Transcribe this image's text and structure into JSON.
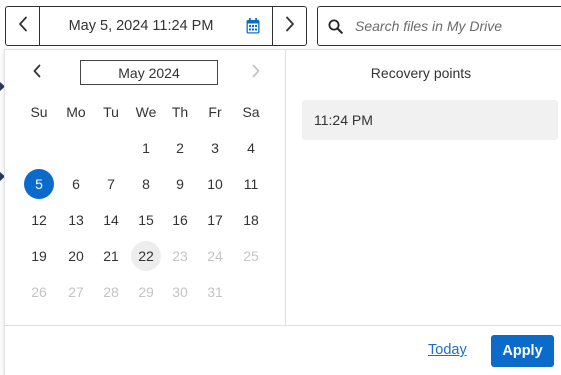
{
  "date_picker": {
    "value": "May 5, 2024 11:24 PM",
    "prev_icon": "chevron-left-icon",
    "next_icon": "chevron-right-icon",
    "calendar_icon": "calendar-icon",
    "accent_color": "#0b6bcb"
  },
  "search": {
    "placeholder": "Search files in My Drive",
    "icon": "search-icon"
  },
  "calendar": {
    "month_label": "May 2024",
    "weekdays": [
      "Su",
      "Mo",
      "Tu",
      "We",
      "Th",
      "Fr",
      "Sa"
    ],
    "selected_day": "5",
    "today_day": "22",
    "weeks": [
      [
        null,
        null,
        null,
        {
          "d": "1"
        },
        {
          "d": "2"
        },
        {
          "d": "3"
        },
        {
          "d": "4"
        }
      ],
      [
        {
          "d": "5"
        },
        {
          "d": "6"
        },
        {
          "d": "7"
        },
        {
          "d": "8"
        },
        {
          "d": "9"
        },
        {
          "d": "10"
        },
        {
          "d": "11"
        }
      ],
      [
        {
          "d": "12"
        },
        {
          "d": "13"
        },
        {
          "d": "14"
        },
        {
          "d": "15"
        },
        {
          "d": "16"
        },
        {
          "d": "17"
        },
        {
          "d": "18"
        }
      ],
      [
        {
          "d": "19"
        },
        {
          "d": "20"
        },
        {
          "d": "21"
        },
        {
          "d": "22"
        },
        {
          "d": "23",
          "disabled": true
        },
        {
          "d": "24",
          "disabled": true
        },
        {
          "d": "25",
          "disabled": true
        }
      ],
      [
        {
          "d": "26",
          "disabled": true
        },
        {
          "d": "27",
          "disabled": true
        },
        {
          "d": "28",
          "disabled": true
        },
        {
          "d": "29",
          "disabled": true
        },
        {
          "d": "30",
          "disabled": true
        },
        {
          "d": "31",
          "disabled": true
        },
        null
      ]
    ],
    "next_disabled": true
  },
  "recovery": {
    "title": "Recovery points",
    "items": [
      "11:24 PM"
    ]
  },
  "footer": {
    "today_label": "Today",
    "apply_label": "Apply"
  }
}
